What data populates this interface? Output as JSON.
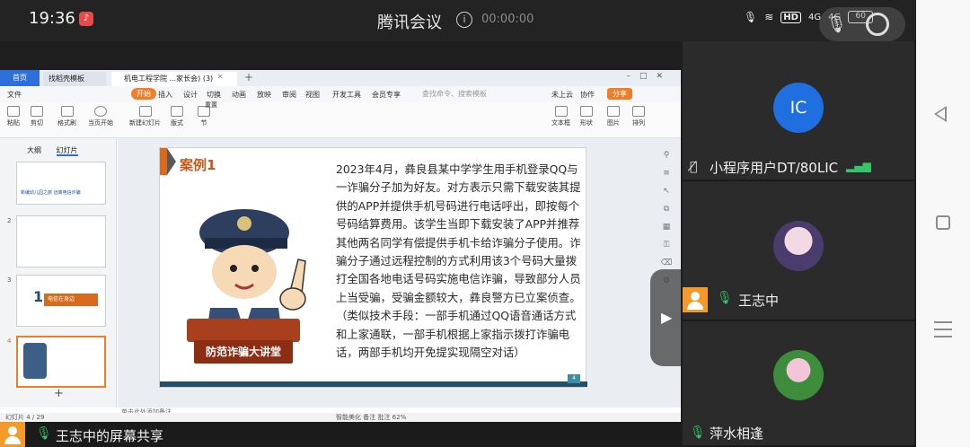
{
  "status": {
    "time": "19:36",
    "meeting_title": "腾讯会议",
    "timer": "00:00:00",
    "hd": "HD",
    "signal1": "4G",
    "signal2": "4G",
    "battery": "60"
  },
  "wps": {
    "tab_home": "首页",
    "tab_template": "找稻壳模板",
    "tab_doc": "机电工程学院 ...家长会) (3)",
    "menu": [
      "文件",
      "开始",
      "插入",
      "设计",
      "切换",
      "动画",
      "放映",
      "审阅",
      "视图",
      "开发工具",
      "会员专享"
    ],
    "search_placeholder": "查找命令、搜索模板",
    "unsaved": "未上云",
    "collab": "协作",
    "share": "分享",
    "ribbon": [
      "粘贴",
      "剪切",
      "格式刷",
      "当页开始",
      "新建幻灯片",
      "版式",
      "节",
      "重置",
      "图片",
      "形状",
      "文本框",
      "排列"
    ],
    "panel_tabs": [
      "大纲",
      "幻灯片"
    ],
    "thumb_numbers": [
      "1",
      "2",
      "3",
      "4"
    ],
    "thumb1_text": "新编幼儿园之旅   远离电信诈骗",
    "thumb3_badge": "电信在身边",
    "thumb3_number": "1",
    "notes_hint": "单击此处添加备注",
    "status_slide": "幻灯片 4 / 29",
    "status_right": "智能美化   备注   批注   62%"
  },
  "slide": {
    "case_title": "案例1",
    "body": "2023年4月，彝良县某中学学生用手机登录QQ与一诈骗分子加为好友。对方表示只需下载安装其提供的APP并提供手机号码进行电话呼出，即按每个号码结算费用。该学生当即下载安装了APP并推荐其他两名同学有偿提供手机卡给诈骗分子使用。诈骗分子通过远程控制的方式利用该3个号码大量拨打全国各地电话号码实施电信诈骗，导致部分人员上当受骗，受骗金额较大，彝良警方已立案侦查。（类似技术手段：一部手机通过QQ语音通话方式和上家通联，一部手机根据上家指示拨打诈骗电话，两部手机均开免提实现隔空对话）",
    "podium_text": "防范诈骗大讲堂",
    "page_num": "4"
  },
  "sharer": {
    "label": "王志中的屏幕共享"
  },
  "participants": [
    {
      "initials": "IC",
      "name": "小程序用户DT/80LIC",
      "mic": "off"
    },
    {
      "name": "王志中",
      "mic": "on"
    },
    {
      "name": "萍水相逢",
      "mic": "on"
    }
  ],
  "colors": {
    "accent": "#f07e28",
    "active_mic": "#37c46a",
    "ic_avatar": "#1f6fe0",
    "podium": "#8c2d14"
  }
}
